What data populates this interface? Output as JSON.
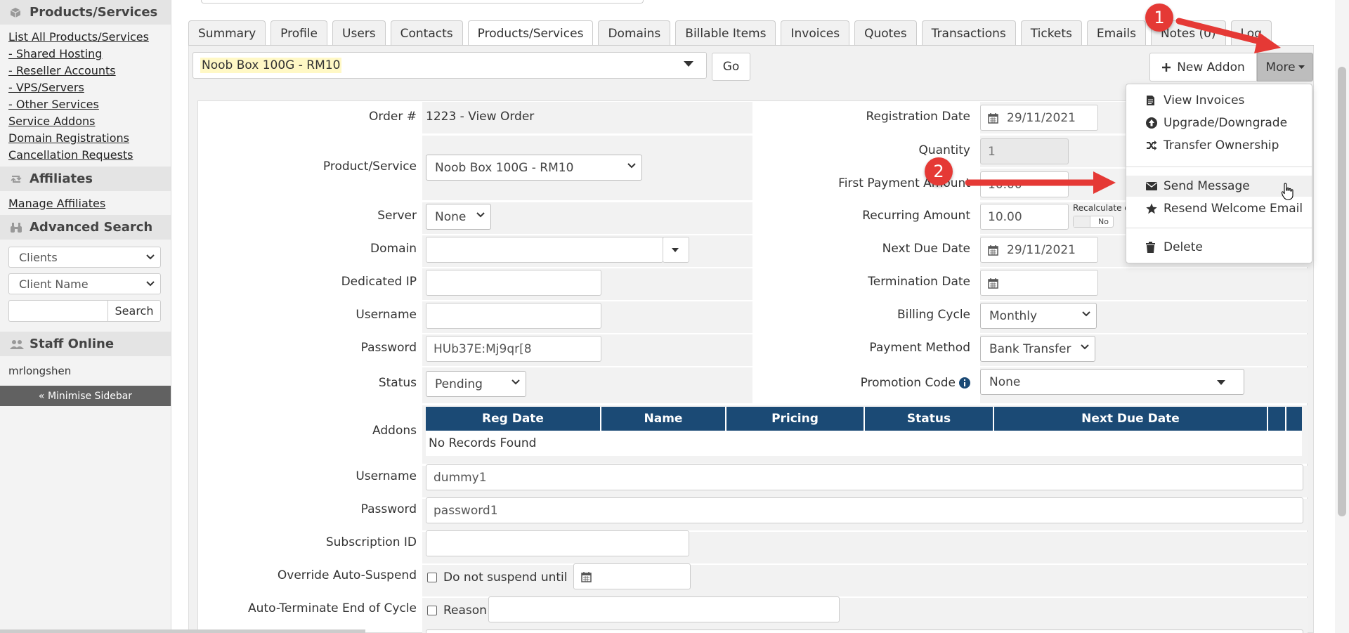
{
  "sidebar": {
    "products_title": "Products/Services",
    "products_links": [
      "List All Products/Services",
      "- Shared Hosting",
      "- Reseller Accounts",
      "- VPS/Servers",
      "- Other Services",
      "Service Addons",
      "Domain Registrations",
      "Cancellation Requests"
    ],
    "affiliates_title": "Affiliates",
    "affiliates_link": "Manage Affiliates",
    "search_title": "Advanced Search",
    "search_type": "Clients",
    "search_field": "Client Name",
    "search_button": "Search",
    "staff_title": "Staff Online",
    "staff_user": "mrlongshen",
    "minimise": "« Minimise Sidebar"
  },
  "tabs": [
    "Summary",
    "Profile",
    "Users",
    "Contacts",
    "Products/Services",
    "Domains",
    "Billable Items",
    "Invoices",
    "Quotes",
    "Transactions",
    "Tickets",
    "Emails",
    "Notes (0)",
    "Log"
  ],
  "active_tab": "Products/Services",
  "service_select": "Noob Box 100G - RM10",
  "go_button": "Go",
  "new_addon_button": "New Addon",
  "more_button": "More",
  "form": {
    "order_label": "Order #",
    "order_value": "1223 - View Order",
    "product_label": "Product/Service",
    "product_value": "Noob Box 100G - RM10",
    "server_label": "Server",
    "server_value": "None",
    "domain_label": "Domain",
    "domain_value": "",
    "dedicated_ip_label": "Dedicated IP",
    "username_label": "Username",
    "password_label": "Password",
    "password_value": "HUb37E:Mj9qr[8",
    "status_label": "Status",
    "status_value": "Pending",
    "reg_date_label": "Registration Date",
    "reg_date_value": "29/11/2021",
    "quantity_label": "Quantity",
    "quantity_value": "1",
    "first_payment_label": "First Payment Amount",
    "first_payment_value": "10.00",
    "recurring_label": "Recurring Amount",
    "recurring_value": "10.00",
    "recalculate_label": "Recalculate o",
    "recalculate_toggle": "No",
    "next_due_label": "Next Due Date",
    "next_due_value": "29/11/2021",
    "termination_label": "Termination Date",
    "billing_cycle_label": "Billing Cycle",
    "billing_cycle_value": "Monthly",
    "payment_method_label": "Payment Method",
    "payment_method_value": "Bank Transfer",
    "promo_label": "Promotion Code",
    "promo_value": "None",
    "addons_label": "Addons",
    "addons_columns": [
      "Reg Date",
      "Name",
      "Pricing",
      "Status",
      "Next Due Date"
    ],
    "addons_empty": "No Records Found",
    "cf_username_label": "Username",
    "cf_username_value": "dummy1",
    "cf_password_label": "Password",
    "cf_password_value": "password1",
    "subscription_label": "Subscription ID",
    "override_label": "Override Auto-Suspend",
    "override_checkbox": "Do not suspend until",
    "autoterm_label": "Auto-Terminate End of Cycle",
    "autoterm_checkbox": "Reason"
  },
  "dropdown": {
    "items": [
      "View Invoices",
      "Upgrade/Downgrade",
      "Transfer Ownership",
      "Send Message",
      "Resend Welcome Email",
      "Delete"
    ]
  },
  "annotations": [
    "1",
    "2"
  ],
  "colors": {
    "table_header": "#1b4a75",
    "annotation": "#e53935",
    "highlight": "#fff8c5"
  }
}
